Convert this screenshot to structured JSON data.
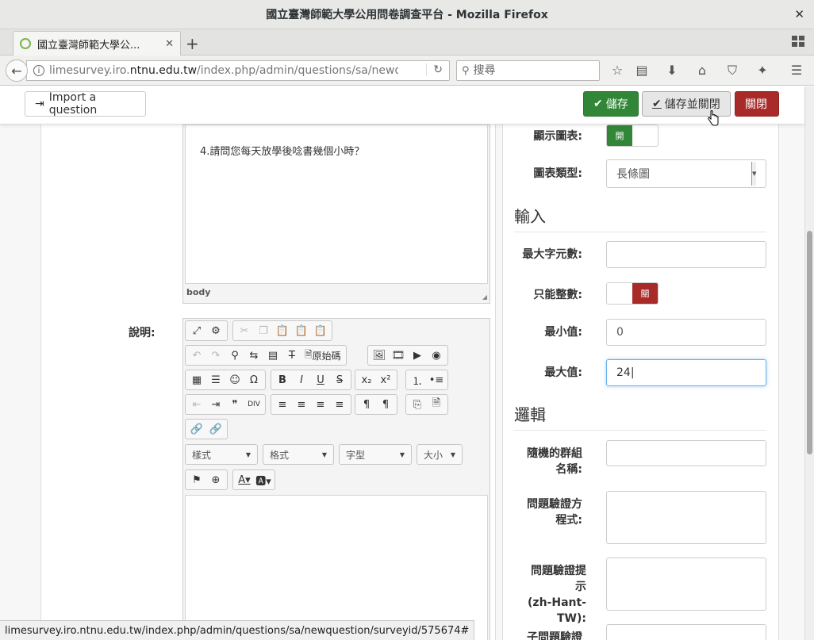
{
  "window": {
    "title": "國立臺灣師範大學公用問卷調查平台 - Mozilla Firefox"
  },
  "tab": {
    "title": "國立臺灣師範大學公..."
  },
  "urlbar": {
    "url_prefix": "limesurvey.iro.",
    "url_domain": "ntnu.edu.tw",
    "url_path": "/index.php/admin/questions/sa/newquestic"
  },
  "search": {
    "placeholder": "搜尋"
  },
  "toolbar": {
    "import_label": "Import a question",
    "save_label": "儲存",
    "saveclose_label": "儲存並關閉",
    "close_label": "關閉"
  },
  "question_editor": {
    "text": "4.請問您每天放學後唸書幾個小時？",
    "path": "body"
  },
  "description": {
    "label": "說明:",
    "source_label": "原始碼",
    "combos": {
      "style": "樣式",
      "format": "格式",
      "font": "字型",
      "size": "大小"
    }
  },
  "settings": {
    "show_chart_label": "顯示圖表:",
    "show_chart_value": "開",
    "chart_type_label": "圖表類型:",
    "chart_type_value": "長條圖",
    "input_section": "輸入",
    "max_chars_label": "最大字元數:",
    "integer_only_label": "只能整數:",
    "integer_only_value": "關",
    "min_label": "最小值:",
    "min_value": "0",
    "max_label": "最大值:",
    "max_value": "24",
    "logic_section": "邏輯",
    "random_group_label_1": "隨機的群組",
    "random_group_label_2": "名稱:",
    "validation_eq_label_1": "問題驗證方",
    "validation_eq_label_2": "程式:",
    "validation_tip_label_1": "問題驗證提",
    "validation_tip_label_2": "示",
    "validation_tip_label_3": "(zh-Hant-TW):",
    "subq_validation_label": "子問題驗證"
  },
  "statusbar": {
    "text": "limesurvey.iro.ntnu.edu.tw/index.php/admin/questions/sa/newquestion/surveyid/575674#"
  },
  "colors": {
    "success": "#328637",
    "danger": "#a82a29",
    "focus": "#66afe9"
  }
}
